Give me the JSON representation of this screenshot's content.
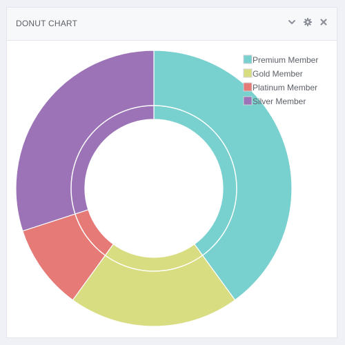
{
  "panel": {
    "title": "DONUT CHART",
    "tools": [
      {
        "name": "chevron-down-icon"
      },
      {
        "name": "gear-icon"
      },
      {
        "name": "close-icon"
      }
    ]
  },
  "chart_data": {
    "type": "pie",
    "donut": true,
    "legend_position": "top-right",
    "series": [
      {
        "name": "Premium Member",
        "value": 40,
        "color": "#79d1cf"
      },
      {
        "name": "Gold Member",
        "value": 20,
        "color": "#d9dd81"
      },
      {
        "name": "Platinum Member",
        "value": 10,
        "color": "#e67a77"
      },
      {
        "name": "Silver Member",
        "value": 30,
        "color": "#9b73b6"
      }
    ]
  }
}
